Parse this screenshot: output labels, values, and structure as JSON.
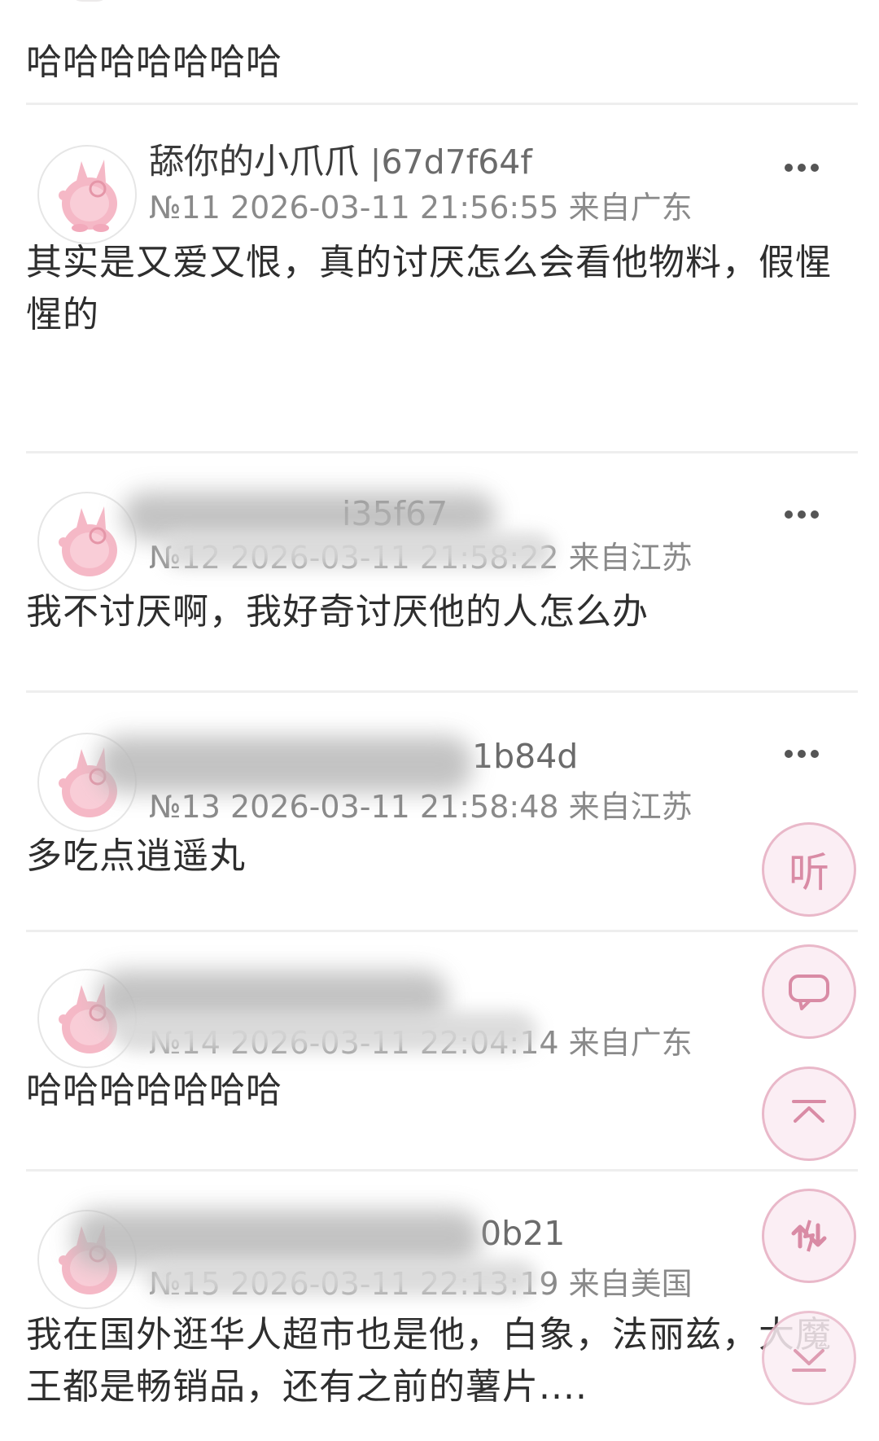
{
  "first_comment_text": "哈哈哈哈哈哈哈",
  "posts": [
    {
      "name": "舔你的小爪爪",
      "hash": "|67d7f64f",
      "floor": "№11",
      "time": "2026-03-11 21:56:55",
      "location": "来自广东",
      "content": "其实是又爱又恨，真的讨厌怎么会看他物料，假惺惺的"
    },
    {
      "name": "",
      "hash": "i35f67",
      "floor": "№12",
      "time": "2026-03-11 21:58:22",
      "location": "来自江苏",
      "content": "我不讨厌啊，我好奇讨厌他的人怎么办"
    },
    {
      "name": "",
      "hash": "1b84d",
      "floor": "№13",
      "time": "2026-03-11 21:58:48",
      "location": "来自江苏",
      "content": "多吃点逍遥丸"
    },
    {
      "name": "",
      "hash": "",
      "floor": "№14",
      "time": "2026-03-11 22:04:14",
      "location": "来自广东",
      "content": "哈哈哈哈哈哈哈"
    },
    {
      "name": "",
      "hash": "0b21",
      "floor": "№15",
      "time": "2026-03-11 22:13:19",
      "location": "来自美国",
      "content": "我在国外逛华人超市也是他，白象，法丽兹，大魔王都是畅销品，还有之前的薯片...."
    }
  ],
  "fab": {
    "listen_label": "听",
    "comment_icon": "speech-bubble-icon",
    "top_icon": "arrow-to-top-icon",
    "swap_icon": "refresh-swap-icon",
    "bottom_icon": "arrow-to-bottom-icon"
  },
  "colors": {
    "accent_pink": "#e9b8c9",
    "fab_bg": "#fbeef4",
    "meta_gray": "#8a8a8a"
  }
}
